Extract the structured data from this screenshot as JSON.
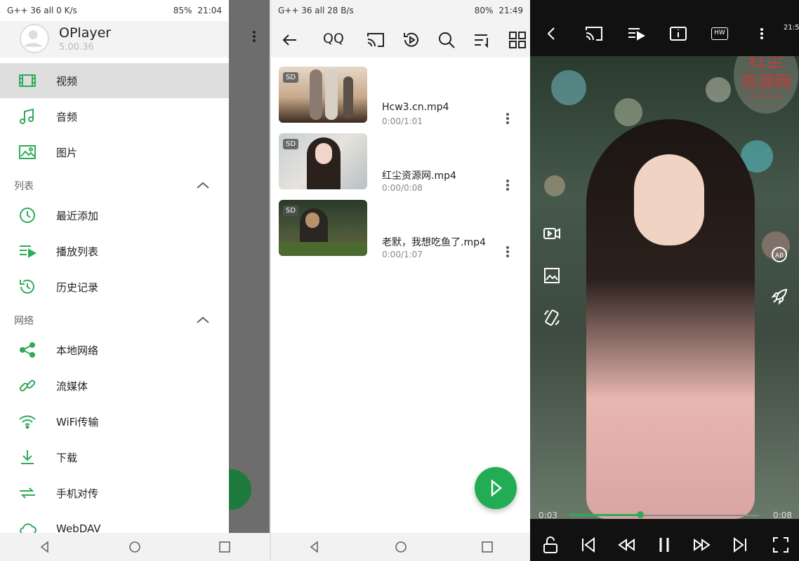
{
  "screen1": {
    "status": {
      "left": "G++ 36 all  0 K/s",
      "battery": "85%",
      "time": "21:04"
    },
    "app": {
      "name": "OPlayer",
      "version": "5.00.36"
    },
    "menu_media": [
      {
        "label": "视频",
        "icon": "video-icon",
        "selected": true
      },
      {
        "label": "音频",
        "icon": "music-icon"
      },
      {
        "label": "图片",
        "icon": "image-icon"
      }
    ],
    "section_list": "列表",
    "menu_list": [
      {
        "label": "最近添加",
        "icon": "clock-icon"
      },
      {
        "label": "播放列表",
        "icon": "playlist-icon"
      },
      {
        "label": "历史记录",
        "icon": "history-icon"
      }
    ],
    "section_network": "网络",
    "menu_network": [
      {
        "label": "本地网络",
        "icon": "share-icon"
      },
      {
        "label": "流媒体",
        "icon": "link-icon"
      },
      {
        "label": "WiFi传输",
        "icon": "wifi-icon"
      },
      {
        "label": "下载",
        "icon": "download-icon"
      },
      {
        "label": "手机对传",
        "icon": "phone-transfer-icon"
      },
      {
        "label": "WebDAV",
        "icon": "cloud-icon"
      }
    ]
  },
  "screen2": {
    "status": {
      "left": "G++ 36 all  28 B/s",
      "battery": "80%",
      "time": "21:49"
    },
    "title": "QQ",
    "videos": [
      {
        "badge": "SD",
        "name": "Hcw3.cn.mp4",
        "duration": "0:00/1:01"
      },
      {
        "badge": "SD",
        "name": "红尘资源网.mp4",
        "duration": "0:00/0:08"
      },
      {
        "badge": "SD",
        "name": "老默，我想吃鱼了.mp4",
        "duration": "0:00/1:07"
      }
    ]
  },
  "screen3": {
    "status_time": "21:5",
    "hw_label": "HW",
    "watermark_line1": "红尘",
    "watermark_line2": "资源网",
    "watermark_url": "www.hcw3.cn",
    "elapsed": "0:03",
    "total": "0:08",
    "progress": 0.375
  },
  "colors": {
    "accent": "#2eab5a",
    "fab": "#22ad55"
  }
}
